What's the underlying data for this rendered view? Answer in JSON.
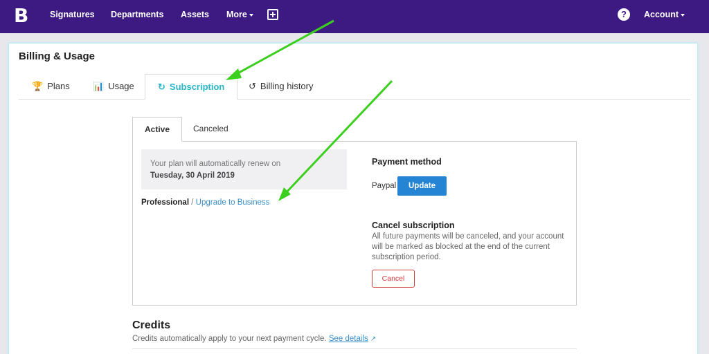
{
  "nav": {
    "logo": "B",
    "items": [
      {
        "label": "Signatures"
      },
      {
        "label": "Departments"
      },
      {
        "label": "Assets"
      },
      {
        "label": "More"
      }
    ],
    "help": "?",
    "account": "Account"
  },
  "page": {
    "title": "Billing & Usage",
    "tabs": [
      {
        "label": "Plans",
        "icon": "trophy-icon"
      },
      {
        "label": "Usage",
        "icon": "bar-chart-icon"
      },
      {
        "label": "Subscription",
        "icon": "refresh-icon",
        "active": true
      },
      {
        "label": "Billing history",
        "icon": "history-icon"
      }
    ]
  },
  "subscription": {
    "subtabs": [
      {
        "label": "Active",
        "active": true
      },
      {
        "label": "Canceled"
      }
    ],
    "renew_text": "Your plan will automatically renew on",
    "renew_date": "Tuesday, 30 April 2019",
    "plan_name": "Professional",
    "plan_sep": "/",
    "upgrade_link": "Upgrade to Business",
    "payment_method_title": "Payment method",
    "payment_method_value": "Paypal",
    "update_label": "Update",
    "cancel_title": "Cancel subscription",
    "cancel_desc": "All future payments will be canceled, and your account will be marked as blocked at the end of the current subscription period.",
    "cancel_label": "Cancel"
  },
  "credits": {
    "title": "Credits",
    "desc": "Credits automatically apply to your next payment cycle.",
    "link": "See details"
  },
  "colors": {
    "nav_bg": "#3d1a82",
    "accent": "#29b6c6",
    "primary_button": "#2684d4",
    "danger": "#d43a3a",
    "annotation_arrow": "#3ccf1f"
  }
}
